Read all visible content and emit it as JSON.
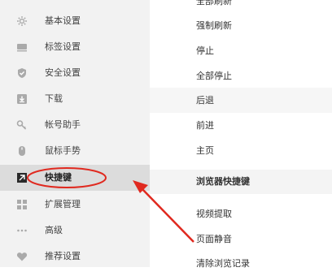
{
  "sidebar": {
    "items": [
      {
        "label": "基本设置",
        "icon": "gear-icon"
      },
      {
        "label": "标签设置",
        "icon": "tab-icon"
      },
      {
        "label": "安全设置",
        "icon": "shield-check-icon"
      },
      {
        "label": "下载",
        "icon": "download-icon"
      },
      {
        "label": "帐号助手",
        "icon": "key-icon"
      },
      {
        "label": "鼠标手势",
        "icon": "mouse-icon"
      },
      {
        "label": "快捷键",
        "icon": "shortcut-icon",
        "active": true
      },
      {
        "label": "扩展管理",
        "icon": "grid-icon"
      },
      {
        "label": "高级",
        "icon": "more-icon"
      },
      {
        "label": "推荐设置",
        "icon": "heart-icon"
      }
    ]
  },
  "main": {
    "items": [
      {
        "label": "全部刷新"
      },
      {
        "label": "强制刷新"
      },
      {
        "label": "停止"
      },
      {
        "label": "全部停止"
      },
      {
        "label": "后退"
      },
      {
        "label": "前进"
      },
      {
        "label": "主页"
      }
    ],
    "section_title": "浏览器快捷键",
    "section_items": [
      {
        "label": "视频提取"
      },
      {
        "label": "页面静音"
      },
      {
        "label": "清除浏览记录"
      }
    ]
  },
  "annotation": {
    "color": "#e0291f"
  }
}
